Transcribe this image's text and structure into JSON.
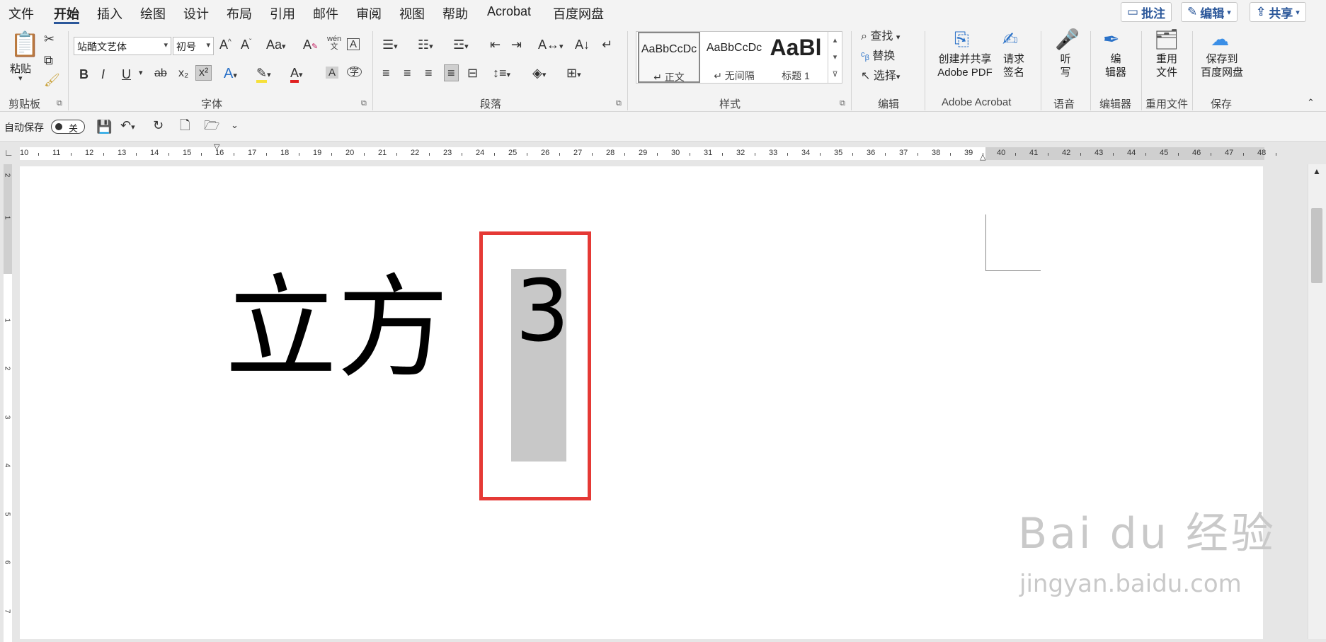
{
  "menu": {
    "tabs": [
      "文件",
      "开始",
      "插入",
      "绘图",
      "设计",
      "布局",
      "引用",
      "邮件",
      "审阅",
      "视图",
      "帮助",
      "Acrobat",
      "百度网盘"
    ],
    "active_tab": "开始",
    "comment_btn": "批注",
    "edit_btn": "编辑",
    "share_btn": "共享"
  },
  "ribbon": {
    "clipboard": {
      "paste": "粘贴",
      "label": "剪贴板"
    },
    "font": {
      "font_name": "站酷文艺体",
      "font_size": "初号",
      "grow": "A^",
      "shrink": "A˅",
      "case": "Aa",
      "phonetic": "wén",
      "phonetic2": "文",
      "bold": "B",
      "italic": "I",
      "underline": "U",
      "strike": "ab",
      "subscript": "x₂",
      "superscript": "x²",
      "label": "字体"
    },
    "paragraph": {
      "label": "段落"
    },
    "styles": {
      "items": [
        {
          "sample": "AaBbCcDc",
          "name": "↵ 正文"
        },
        {
          "sample": "AaBbCcDc",
          "name": "↵ 无间隔"
        },
        {
          "sample": "AaBl",
          "name": "标题 1"
        }
      ],
      "label": "样式"
    },
    "editing": {
      "find": "查找",
      "replace": "替换",
      "select": "选择",
      "label": "编辑"
    },
    "acrobat": {
      "create_share_1": "创建并共享",
      "create_share_2": "Adobe PDF",
      "request_sign_1": "请求",
      "request_sign_2": "签名",
      "label": "Adobe Acrobat"
    },
    "voice": {
      "dictate_1": "听",
      "dictate_2": "写",
      "label": "语音"
    },
    "editor": {
      "editor_1": "编",
      "editor_2": "辑器",
      "label": "编辑器"
    },
    "reuse": {
      "reuse_1": "重用",
      "reuse_2": "文件",
      "label": "重用文件"
    },
    "save": {
      "save_1": "保存到",
      "save_2": "百度网盘",
      "label": "保存"
    }
  },
  "qat": {
    "autosave": "自动保存",
    "autosave_state": "关"
  },
  "ruler": {
    "numbers": [
      "10",
      "11",
      "12",
      "13",
      "14",
      "15",
      "16",
      "17",
      "18",
      "19",
      "20",
      "21",
      "22",
      "23",
      "24",
      "25",
      "26",
      "27",
      "28",
      "29",
      "30",
      "31",
      "32",
      "33",
      "34",
      "35",
      "36",
      "37",
      "38",
      "39",
      "40",
      "41",
      "42",
      "43",
      "44",
      "45",
      "46",
      "47",
      "48"
    ]
  },
  "vruler": {
    "numbers": [
      "2",
      "1",
      "1",
      "2",
      "3",
      "4",
      "5",
      "6",
      "7"
    ]
  },
  "document": {
    "main_text": "立方",
    "superscript_text": "3"
  },
  "watermark": {
    "logo": "Bai du 经验",
    "url": "jingyan.baidu.com"
  },
  "colors": {
    "accent": "#2b579a",
    "highlight_frame": "#e53935",
    "selection": "#c8c8c8"
  }
}
